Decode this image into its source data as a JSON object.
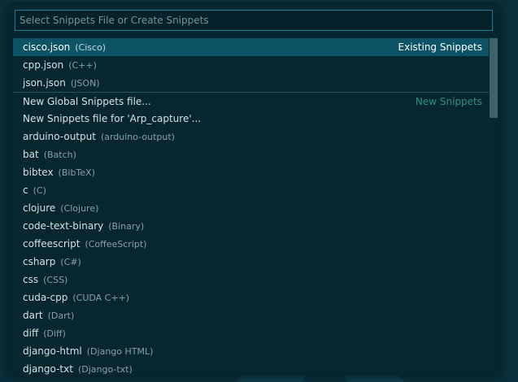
{
  "quick_pick": {
    "placeholder": "Select Snippets File or Create Snippets",
    "items": [
      {
        "label": "cisco.json",
        "desc": "(Cisco)",
        "group": "Existing Snippets"
      },
      {
        "label": "cpp.json",
        "desc": "(C++)",
        "group": ""
      },
      {
        "label": "json.json",
        "desc": "(JSON)",
        "group": ""
      },
      {
        "label": "New Global Snippets file...",
        "desc": "",
        "group": "New Snippets"
      },
      {
        "label": "New Snippets file for 'Arp_capture'...",
        "desc": "",
        "group": ""
      },
      {
        "label": "arduino-output",
        "desc": "(arduino-output)",
        "group": ""
      },
      {
        "label": "bat",
        "desc": "(Batch)",
        "group": ""
      },
      {
        "label": "bibtex",
        "desc": "(BibTeX)",
        "group": ""
      },
      {
        "label": "c",
        "desc": "(C)",
        "group": ""
      },
      {
        "label": "clojure",
        "desc": "(Clojure)",
        "group": ""
      },
      {
        "label": "code-text-binary",
        "desc": "(Binary)",
        "group": ""
      },
      {
        "label": "coffeescript",
        "desc": "(CoffeeScript)",
        "group": ""
      },
      {
        "label": "csharp",
        "desc": "(C#)",
        "group": ""
      },
      {
        "label": "css",
        "desc": "(CSS)",
        "group": ""
      },
      {
        "label": "cuda-cpp",
        "desc": "(CUDA C++)",
        "group": ""
      },
      {
        "label": "dart",
        "desc": "(Dart)",
        "group": ""
      },
      {
        "label": "diff",
        "desc": "(Diff)",
        "group": ""
      },
      {
        "label": "django-html",
        "desc": "(Django HTML)",
        "group": ""
      },
      {
        "label": "django-txt",
        "desc": "(Django-txt)",
        "group": ""
      }
    ]
  },
  "colors": {
    "selection": "#0c5366",
    "input_border": "#1b7d8f",
    "panel": "#062630",
    "group_muted": "#2f8f86"
  }
}
